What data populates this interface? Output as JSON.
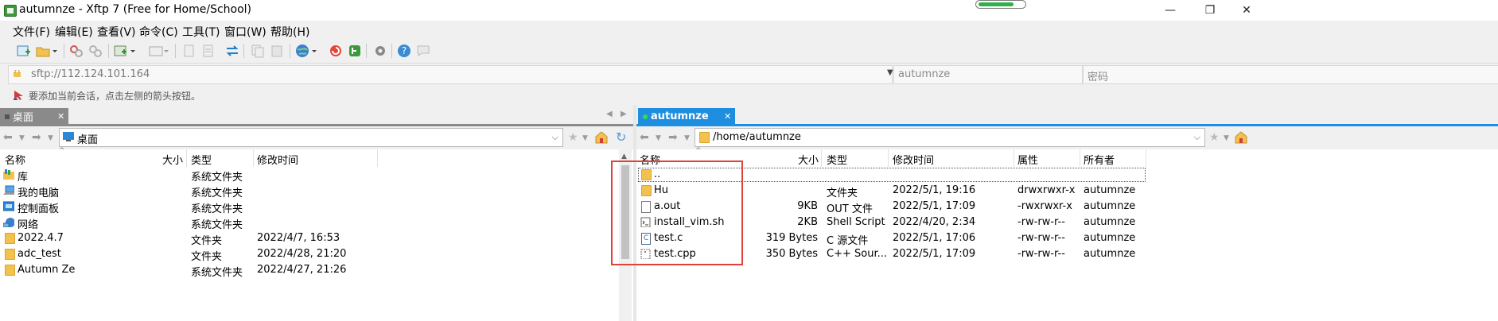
{
  "window": {
    "title": "autumnze - Xftp 7 (Free for Home/School)",
    "progress_fraction": 0.78,
    "controls": {
      "minimize": "—",
      "maximize": "❐",
      "close": "✕"
    }
  },
  "menu": {
    "items": [
      "文件(F)",
      "编辑(E)",
      "查看(V)",
      "命令(C)",
      "工具(T)",
      "窗口(W)",
      "帮助(H)"
    ]
  },
  "address": {
    "url_placeholder": "sftp://112.124.101.164",
    "user_placeholder": "autumnze",
    "password_placeholder": "密码"
  },
  "hint": "要添加当前会话，点击左侧的箭头按钮。",
  "left_pane": {
    "tab_label": "桌面",
    "path": "桌面",
    "columns": [
      "名称",
      "大小",
      "类型",
      "修改时间"
    ],
    "rows": [
      {
        "name": "库",
        "size": "",
        "type": "系统文件夹",
        "modified": "",
        "icon": "library-icon"
      },
      {
        "name": "我的电脑",
        "size": "",
        "type": "系统文件夹",
        "modified": "",
        "icon": "computer-icon"
      },
      {
        "name": "控制面板",
        "size": "",
        "type": "系统文件夹",
        "modified": "",
        "icon": "control-panel-icon"
      },
      {
        "name": "网络",
        "size": "",
        "type": "系统文件夹",
        "modified": "",
        "icon": "network-icon"
      },
      {
        "name": "2022.4.7",
        "size": "",
        "type": "文件夹",
        "modified": "2022/4/7, 16:53",
        "icon": "folder-icon"
      },
      {
        "name": "adc_test",
        "size": "",
        "type": "文件夹",
        "modified": "2022/4/28, 21:20",
        "icon": "folder-icon"
      },
      {
        "name": "Autumn Ze",
        "size": "",
        "type": "系统文件夹",
        "modified": "2022/4/27, 21:26",
        "icon": "folder-icon"
      }
    ]
  },
  "right_pane": {
    "tab_label": "autumnze",
    "path": "/home/autumnze",
    "columns": [
      "名称",
      "大小",
      "类型",
      "修改时间",
      "属性",
      "所有者"
    ],
    "rows": [
      {
        "name": "..",
        "size": "",
        "type": "",
        "modified": "",
        "attrs": "",
        "owner": "",
        "icon": "parent-folder-icon"
      },
      {
        "name": "Hu",
        "size": "",
        "type": "文件夹",
        "modified": "2022/5/1, 19:16",
        "attrs": "drwxrwxr-x",
        "owner": "autumnze",
        "icon": "folder-icon"
      },
      {
        "name": "a.out",
        "size": "9KB",
        "type": "OUT 文件",
        "modified": "2022/5/1, 17:09",
        "attrs": "-rwxrwxr-x",
        "owner": "autumnze",
        "icon": "file-icon"
      },
      {
        "name": "install_vim.sh",
        "size": "2KB",
        "type": "Shell Script",
        "modified": "2022/4/20, 2:34",
        "attrs": "-rw-rw-r--",
        "owner": "autumnze",
        "icon": "script-icon"
      },
      {
        "name": "test.c",
        "size": "319 Bytes",
        "type": "C 源文件",
        "modified": "2022/5/1, 17:06",
        "attrs": "-rw-rw-r--",
        "owner": "autumnze",
        "icon": "c-file-icon"
      },
      {
        "name": "test.cpp",
        "size": "350 Bytes",
        "type": "C++ Sour...",
        "modified": "2022/5/1, 17:09",
        "attrs": "-rw-rw-r--",
        "owner": "autumnze",
        "icon": "cpp-file-icon"
      }
    ]
  },
  "colors": {
    "active_tab": "#1e8fe0",
    "inactive_tab": "#8a8a8a",
    "highlight_box": "#e0413a",
    "folder": "#f2c24e"
  }
}
